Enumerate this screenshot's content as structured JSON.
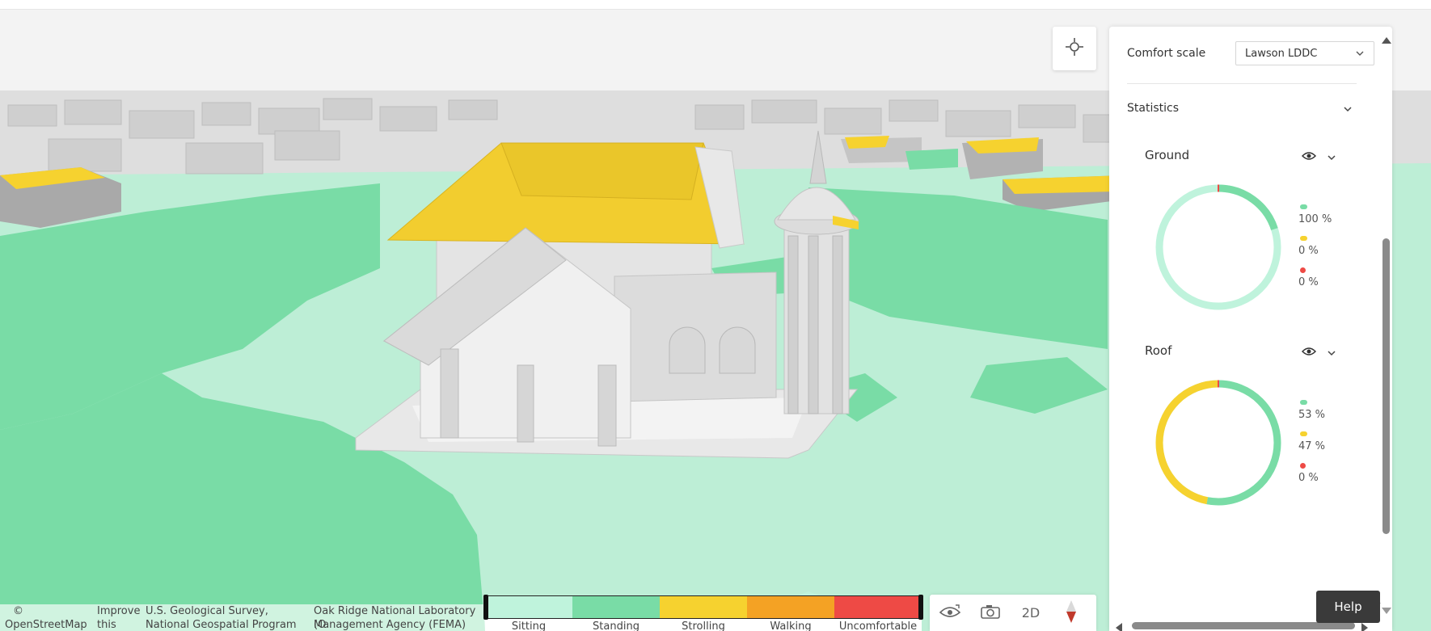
{
  "panel": {
    "comfort_scale_label": "Comfort scale",
    "comfort_scale_value": "Lawson LDDC",
    "statistics_label": "Statistics",
    "sections": [
      {
        "title": "Ground",
        "segments": [
          {
            "category": "standing",
            "percent": 100,
            "label": "100 %"
          },
          {
            "category": "strolling",
            "percent": 0,
            "label": "0 %"
          },
          {
            "category": "uncomfortable",
            "percent": 0,
            "label": "0 %"
          }
        ]
      },
      {
        "title": "Roof",
        "segments": [
          {
            "category": "standing",
            "percent": 53,
            "label": "53 %"
          },
          {
            "category": "strolling",
            "percent": 47,
            "label": "47 %"
          },
          {
            "category": "uncomfortable",
            "percent": 0,
            "label": "0 %"
          }
        ]
      }
    ]
  },
  "legend": {
    "categories": [
      {
        "label": "Sitting",
        "color": "#bff3dc"
      },
      {
        "label": "Standing",
        "color": "#79dca6"
      },
      {
        "label": "Strolling",
        "color": "#f6d22f"
      },
      {
        "label": "Walking",
        "color": "#f4a224"
      },
      {
        "label": "Uncomfortable",
        "color": "#ee4a45"
      }
    ]
  },
  "tools": {
    "view_2d_label": "2D",
    "icons": [
      "eye-icon",
      "camera-icon",
      "compass-icon"
    ]
  },
  "attribution": [
    "©",
    "OpenStreetMap",
    "Improve",
    "this",
    "U.S. Geological Survey,",
    "National Geospatial Program",
    "Oak Ridge National Laboratory (O",
    "Management Agency (FEMA) Geo"
  ],
  "help_label": "Help",
  "colors": {
    "sitting": "#bff3dc",
    "standing": "#79dca6",
    "strolling": "#f6d22f",
    "uncomfortable": "#ee4a45",
    "building": "#e4e4e4"
  }
}
